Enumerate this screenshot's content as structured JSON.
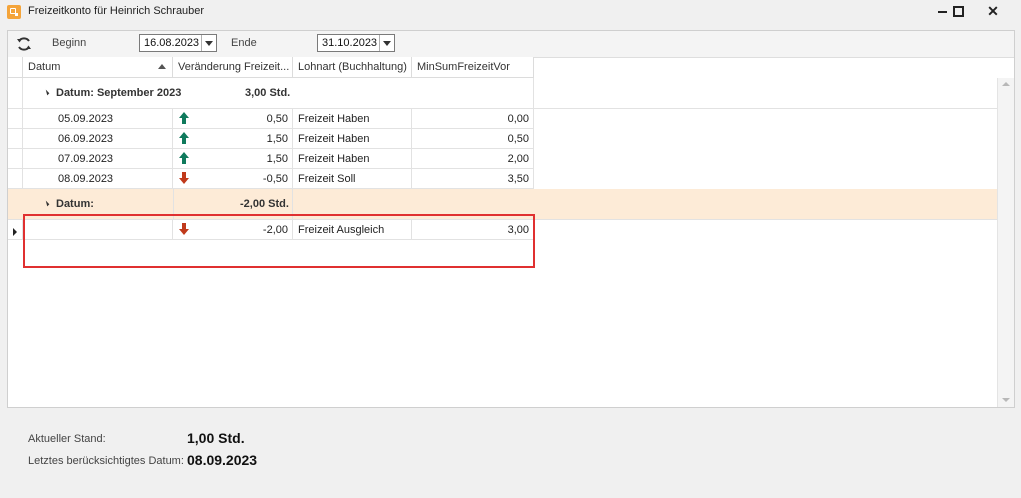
{
  "window": {
    "title": "Freizeitkonto für Heinrich Schrauber",
    "minimize_icon": "minimize-icon",
    "maximize_icon": "maximize-icon",
    "close_label": "✕"
  },
  "toolbar": {
    "refresh_icon": "refresh-icon",
    "begin_label": "Beginn",
    "begin_value": "16.08.2023",
    "end_label": "Ende",
    "end_value": "31.10.2023"
  },
  "grid": {
    "columns": [
      "Datum",
      "Veränderung Freizeit...",
      "Lohnart (Buchhaltung)",
      "MinSumFreizeitVor"
    ],
    "sort": "Datum ascending",
    "groups": [
      {
        "label": "Datum: September 2023",
        "total": "3,00 Std.",
        "rows": [
          {
            "date": "05.09.2023",
            "direction": "up",
            "change": "0,50",
            "lohnart": "Freizeit Haben",
            "min": "0,00"
          },
          {
            "date": "06.09.2023",
            "direction": "up",
            "change": "1,50",
            "lohnart": "Freizeit Haben",
            "min": "0,50"
          },
          {
            "date": "07.09.2023",
            "direction": "up",
            "change": "1,50",
            "lohnart": "Freizeit Haben",
            "min": "2,00"
          },
          {
            "date": "08.09.2023",
            "direction": "down",
            "change": "-0,50",
            "lohnart": "Freizeit Soll",
            "min": "3,50"
          }
        ]
      },
      {
        "label": "Datum:",
        "total": "-2,00 Std.",
        "rows": [
          {
            "date": "",
            "direction": "down",
            "change": "-2,00",
            "lohnart": "Freizeit Ausgleich",
            "min": "3,00"
          }
        ]
      }
    ],
    "colors": {
      "up": "#0f7a5c",
      "down": "#c0391b",
      "selected_group_bg": "#fdebd7",
      "highlight": "#e03030"
    }
  },
  "footer": {
    "current_label": "Aktueller Stand:",
    "current_value": "1,00 Std.",
    "last_date_label": "Letztes berücksichtigtes Datum:",
    "last_date_value": "08.09.2023"
  }
}
